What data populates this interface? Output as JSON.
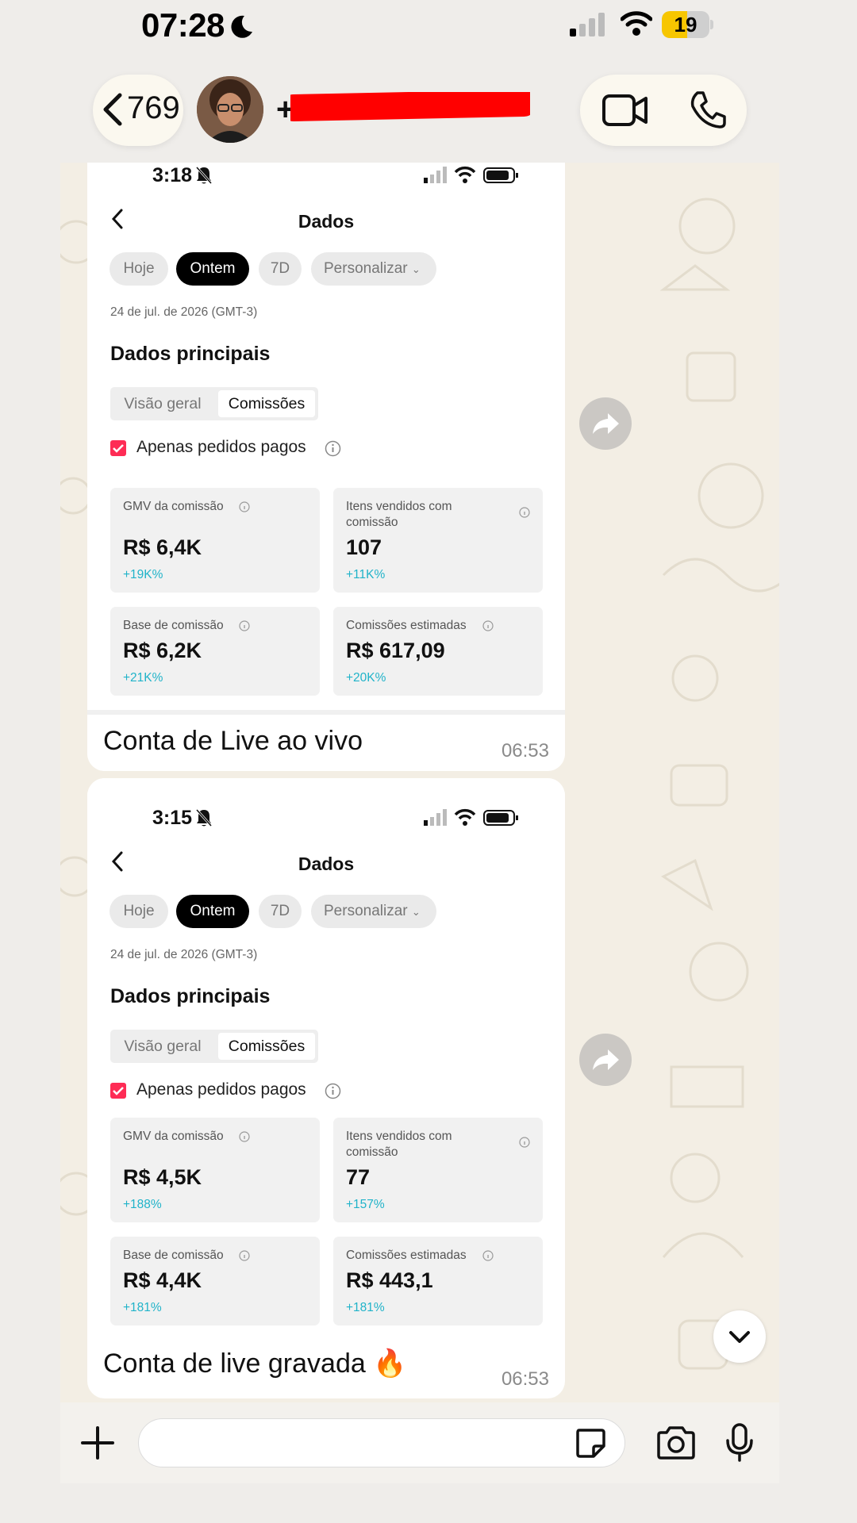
{
  "status_bar": {
    "time": "07:28",
    "battery": "19"
  },
  "header": {
    "back_count": "769",
    "contact_name": "+"
  },
  "messages": [
    {
      "screenshot": {
        "time": "3:18",
        "title": "Dados",
        "chips": [
          "Hoje",
          "Ontem",
          "7D",
          "Personalizar"
        ],
        "date": "24 de jul. de 2026 (GMT-3)",
        "heading": "Dados principais",
        "tabs": [
          "Visão geral",
          "Comissões"
        ],
        "checkbox_label": "Apenas pedidos pagos",
        "cards": [
          {
            "label": "GMV da comissão",
            "value": "R$ 6,4K",
            "change": "+19K%"
          },
          {
            "label": "Itens vendidos com comissão",
            "value": "107",
            "change": "+11K%"
          },
          {
            "label": "Base de comissão",
            "value": "R$ 6,2K",
            "change": "+21K%"
          },
          {
            "label": "Comissões estimadas",
            "value": "R$ 617,09",
            "change": "+20K%"
          }
        ]
      },
      "caption": "Conta de Live ao vivo",
      "timestamp": "06:53"
    },
    {
      "screenshot": {
        "time": "3:15",
        "title": "Dados",
        "chips": [
          "Hoje",
          "Ontem",
          "7D",
          "Personalizar"
        ],
        "date": "24 de jul. de 2026 (GMT-3)",
        "heading": "Dados principais",
        "tabs": [
          "Visão geral",
          "Comissões"
        ],
        "checkbox_label": "Apenas pedidos pagos",
        "cards": [
          {
            "label": "GMV da comissão",
            "value": "R$ 4,5K",
            "change": "+188%"
          },
          {
            "label": "Itens vendidos com comissão",
            "value": "77",
            "change": "+157%"
          },
          {
            "label": "Base de comissão",
            "value": "R$ 4,4K",
            "change": "+181%"
          },
          {
            "label": "Comissões estimadas",
            "value": "R$ 443,1",
            "change": "+181%"
          }
        ]
      },
      "caption": "Conta de live gravada 🔥",
      "timestamp": "06:53"
    }
  ],
  "composer": {
    "placeholder": ""
  },
  "icons": {
    "moon": "moon-icon",
    "signal": "cellular-signal-icon",
    "wifi": "wifi-icon",
    "video": "video-call-icon",
    "phone": "voice-call-icon",
    "forward": "forward-icon",
    "scroll": "chevron-down-icon",
    "plus": "plus-icon",
    "sticker": "sticker-icon",
    "camera": "camera-icon",
    "mic": "microphone-icon"
  },
  "colors": {
    "accent_red": "#fe2c55",
    "change_teal": "#20b3c9",
    "battery_yellow": "#f7c600",
    "redaction": "#ff0000"
  }
}
